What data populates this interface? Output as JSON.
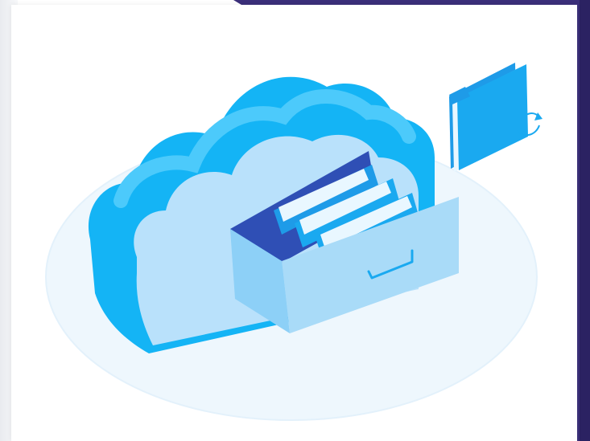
{
  "colors": {
    "page_background": "#ffffff",
    "accent_corner": "#3b2f7a",
    "cloud_front": "#b9e1fb",
    "cloud_side": "#14b4f5",
    "cloud_top": "#35c4fa",
    "drawer_front": "#a9dbf8",
    "drawer_inner": "#2f4fb5",
    "folder_blue": "#1aa9f0",
    "ground_ellipse": "#eef7fd"
  },
  "icons": [
    "cloud-storage-illustration",
    "file-drawer-icon",
    "folder-sync-icon"
  ]
}
